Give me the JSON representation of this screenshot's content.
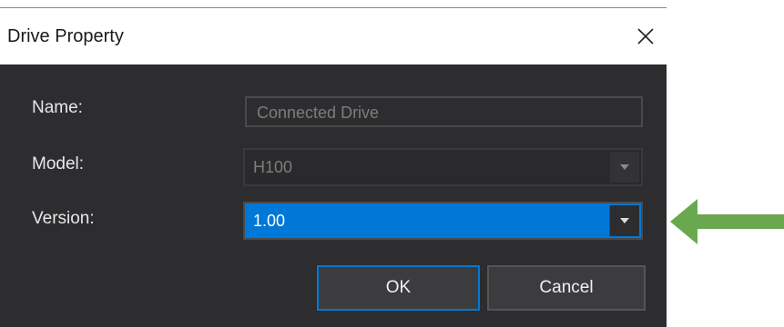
{
  "window": {
    "title": "Drive Property"
  },
  "form": {
    "name": {
      "label": "Name:",
      "value": "Connected Drive"
    },
    "model": {
      "label": "Model:",
      "value": "H100"
    },
    "version": {
      "label": "Version:",
      "value": "1.00"
    }
  },
  "buttons": {
    "ok": "OK",
    "cancel": "Cancel"
  },
  "icons": {
    "close": "close-icon",
    "dropdown": "chevron-down-icon",
    "annotation": "arrow-left-icon"
  },
  "colors": {
    "accent": "#0078d7",
    "dialog_bg": "#2d2d30",
    "annotation": "#6aa84f"
  }
}
